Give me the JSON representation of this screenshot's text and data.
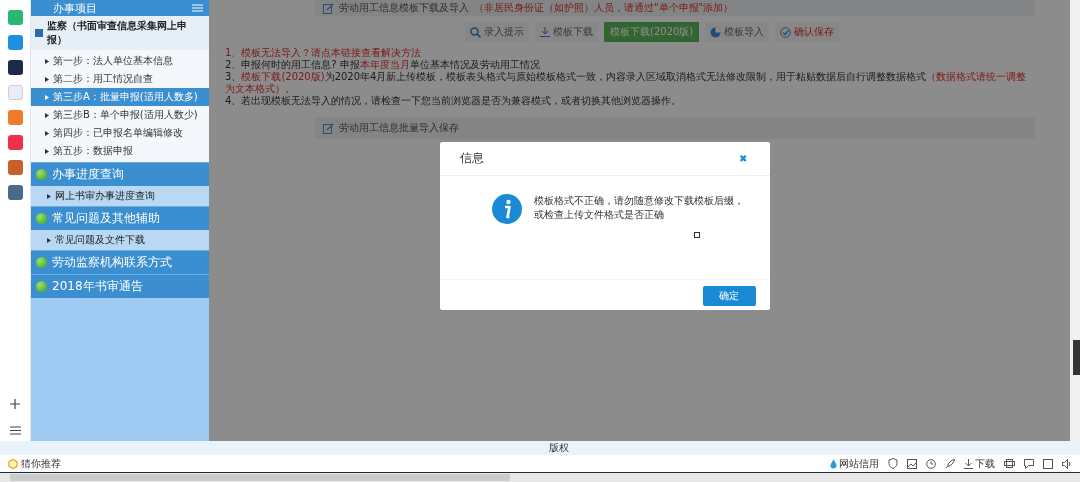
{
  "sidebar": {
    "header": "办事项目",
    "subheader": "监察（书面审查信息采集网上申报）",
    "steps": [
      {
        "label": "第一步：法人单位基本信息",
        "selected": false
      },
      {
        "label": "第二步：用工情况自查",
        "selected": false
      },
      {
        "label": "第三步A：批量申报(适用人数多)",
        "selected": true
      },
      {
        "label": "第三步B：单个申报(适用人数少)",
        "selected": false
      },
      {
        "label": "第四步：已申报名单编辑修改",
        "selected": false
      },
      {
        "label": "第五步：数据申报",
        "selected": false
      }
    ],
    "sections": [
      {
        "label": "办事进度查询",
        "children": [
          {
            "label": "网上书审办事进度查询"
          }
        ]
      },
      {
        "label": "常见问题及其他辅助",
        "children": [
          {
            "label": "常见问题及文件下载"
          }
        ]
      },
      {
        "label": "劳动监察机构联系方式"
      },
      {
        "label": "2018年书审通告"
      }
    ]
  },
  "main": {
    "top_panel": {
      "title": "劳动用工信息模板下载及导入",
      "note": "（非居民身份证（如护照）人员，请通过\"单个申报\"添加）"
    },
    "toolbar": [
      {
        "kind": "search",
        "label": "录入提示"
      },
      {
        "kind": "download",
        "label": "模板下载"
      },
      {
        "kind": "primary",
        "label": "模板下载(2020版)"
      },
      {
        "kind": "import",
        "label": "模板导入"
      },
      {
        "kind": "confirm",
        "label": "确认保存"
      }
    ],
    "notes": [
      {
        "parts": [
          {
            "text": "1、模板无法导入？请点本链接查看解决方法",
            "emphasis": true
          }
        ]
      },
      {
        "parts": [
          {
            "text": "2、申报何时的用工信息? 申报",
            "emphasis": false
          },
          {
            "text": "本年度当月",
            "emphasis": true
          },
          {
            "text": "单位基本情况及劳动用工情况",
            "emphasis": false
          }
        ]
      },
      {
        "parts": [
          {
            "text": "3、",
            "emphasis": false
          },
          {
            "text": "模板下载(2020版)",
            "emphasis": true
          },
          {
            "text": "为2020年4月新上传模板，模板表头格式与原始模板格式一致，内容录入区域取消格式无法修改限制，用于粘贴数据后自行调整数据格式",
            "emphasis": false
          },
          {
            "text": "（数据格式请统一调整为文本格式）",
            "emphasis": true
          },
          {
            "text": "。",
            "emphasis": false
          }
        ]
      },
      {
        "parts": [
          {
            "text": "4、若出现模板无法导入的情况，请检查一下您当前浏览器是否为兼容模式，或者切换其他浏览器操作。",
            "emphasis": false
          }
        ]
      }
    ],
    "import_panel": {
      "title": "劳动用工信息批量导入保存"
    }
  },
  "dialog": {
    "title": "信息",
    "close": "✖",
    "message": "模板格式不正确，请勿随意修改下载模板后缀，或检查上传文件格式是否正确",
    "confirm": "确定"
  },
  "footer": "版权",
  "status_bar": {
    "left": "猜你推荐",
    "items": [
      {
        "kind": "credit",
        "label": "网站信用"
      },
      {
        "kind": "download",
        "label": "下载"
      }
    ]
  }
}
